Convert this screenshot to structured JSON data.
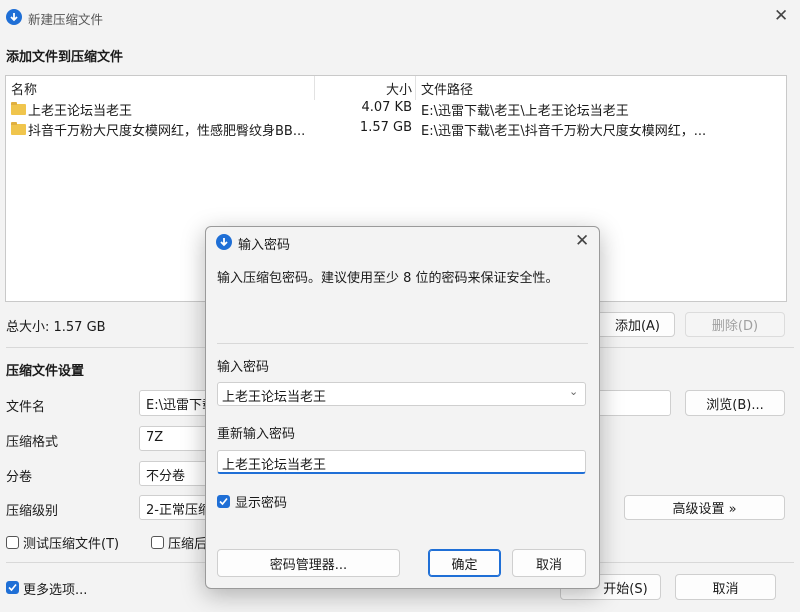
{
  "window": {
    "title": "新建压缩文件"
  },
  "add_section": {
    "title": "添加文件到压缩文件"
  },
  "filelist": {
    "columns": [
      "名称",
      "大小",
      "文件路径"
    ],
    "rows": [
      {
        "name": "上老王论坛当老王",
        "size": "4.07 KB",
        "path": "E:\\迅雷下载\\老王\\上老王论坛当老王"
      },
      {
        "name": "抖音千万粉大尺度女模网红，性感肥臀纹身BB...",
        "size": "1.57 GB",
        "path": "E:\\迅雷下载\\老王\\抖音千万粉大尺度女模网红，..."
      }
    ]
  },
  "total": {
    "label": "总大小: 1.57 GB"
  },
  "buttons": {
    "add": "添加(A)",
    "delete": "删除(D)",
    "browse": "浏览(B)...",
    "advanced": "高级设置 »",
    "start": "开始(S)",
    "cancel": "取消"
  },
  "settings": {
    "title": "压缩文件设置",
    "filename_label": "文件名",
    "filename_value": "E:\\迅雷下载",
    "format_label": "压缩格式",
    "format_value": "7Z",
    "split_label": "分卷",
    "split_value": "不分卷",
    "level_label": "压缩级别",
    "level_value": "2-正常压缩",
    "test_label": "测试压缩文件(T)",
    "after_label": "压缩后",
    "more_label": "更多选项..."
  },
  "dialog": {
    "title": "输入密码",
    "description": "输入压缩包密码。建议使用至少 8 位的密码来保证安全性。",
    "password_label": "输入密码",
    "password_value": "上老王论坛当老王",
    "confirm_label": "重新输入密码",
    "confirm_value": "上老王论坛当老王",
    "show_password_label": "显示密码",
    "manager_button": "密码管理器...",
    "ok_button": "确定",
    "cancel_button": "取消"
  },
  "colors": {
    "accent": "#1f6fd6",
    "folder": "#f0c54d"
  }
}
